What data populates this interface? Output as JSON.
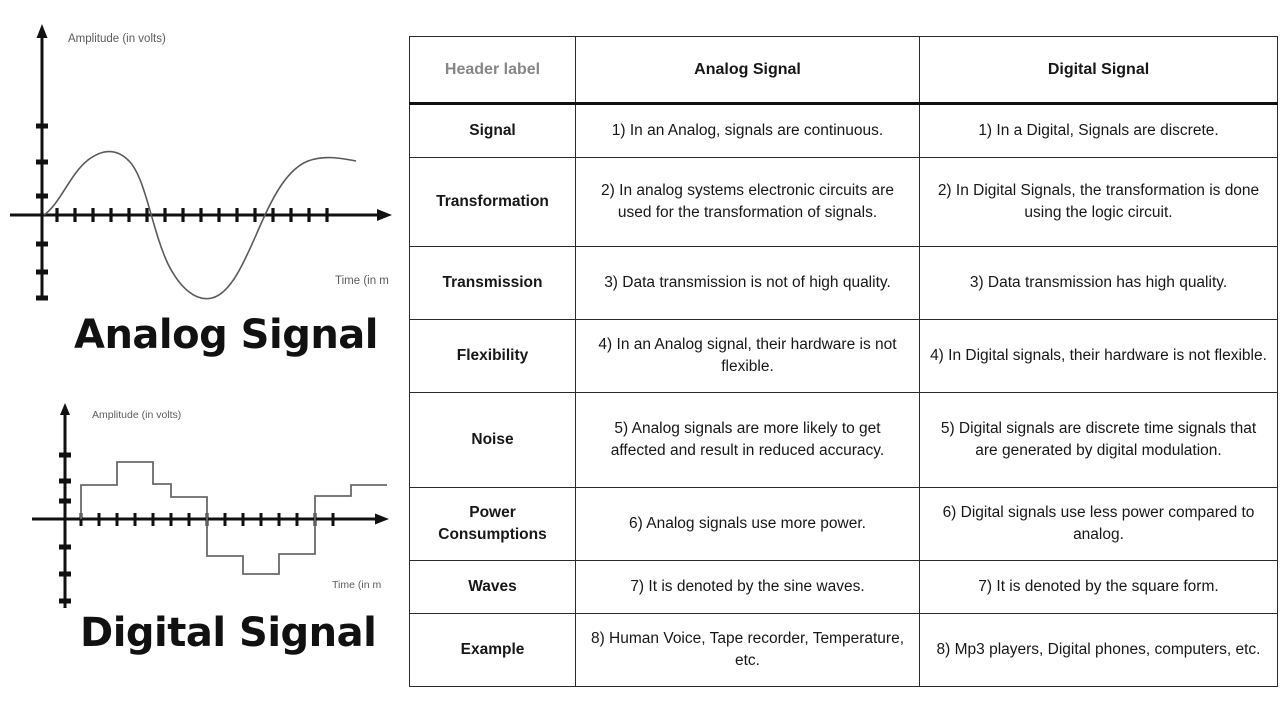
{
  "figures": {
    "analog": {
      "caption": "Analog Signal",
      "y_axis_label": "Amplitude (in volts)",
      "x_axis_label": "Time (in m"
    },
    "digital": {
      "caption": "Digital Signal",
      "y_axis_label": "Amplitude (in volts)",
      "x_axis_label": "Time (in m"
    }
  },
  "chart_data": [
    {
      "type": "line",
      "title": "Analog Signal",
      "xlabel": "Time (in m",
      "ylabel": "Amplitude (in volts)",
      "grid": false,
      "legend": "none",
      "x_tick_count": 17,
      "y_tick_count_positive": 3,
      "y_tick_count_negative": 3,
      "xlim": [
        0,
        16
      ],
      "ylim": [
        -3,
        3
      ],
      "series": [
        {
          "name": "analog sine",
          "x": [
            0,
            1,
            2,
            3,
            4,
            5,
            6,
            7,
            8,
            9,
            10,
            11,
            12,
            13,
            14,
            15,
            16
          ],
          "values": [
            0,
            1.1,
            1.85,
            2.0,
            1.6,
            0.7,
            -0.45,
            -1.5,
            -2.1,
            -2.2,
            -1.75,
            -0.7,
            0.4,
            1.35,
            1.85,
            2.0,
            2.0
          ]
        }
      ]
    },
    {
      "type": "line",
      "title": "Digital Signal",
      "xlabel": "Time (in m",
      "ylabel": "Amplitude (in volts)",
      "grid": false,
      "legend": "none",
      "step_style": "post",
      "x_tick_count": 17,
      "y_tick_count_positive": 3,
      "y_tick_count_negative": 3,
      "xlim": [
        0,
        16
      ],
      "ylim": [
        -3,
        3
      ],
      "series": [
        {
          "name": "digital steps",
          "x": [
            0,
            1,
            2,
            3,
            4,
            5,
            6,
            7,
            8,
            9,
            10,
            11,
            12,
            13,
            14,
            15,
            16
          ],
          "values": [
            0,
            0,
            1.3,
            1.9,
            1.9,
            1.2,
            1.2,
            0.8,
            0.8,
            -1.5,
            -1.5,
            -2.1,
            -2.1,
            -1.5,
            -1.5,
            0.8,
            1.3
          ]
        }
      ]
    }
  ],
  "table": {
    "headers": {
      "col1": "Header label",
      "col2": "Analog Signal",
      "col3": "Digital Signal"
    },
    "rows": [
      {
        "label": "Signal",
        "analog": "1) In an Analog, signals are continuous.",
        "digital": "1) In a Digital, Signals are discrete."
      },
      {
        "label": "Transformation",
        "analog": "2) In analog systems electronic circuits are\nused for the transformation of signals.",
        "digital": "2) In Digital Signals, the transformation is done using the logic circuit."
      },
      {
        "label": "Transmission",
        "analog": "3) Data transmission is not of high quality.",
        "digital": "3) Data transmission has high quality."
      },
      {
        "label": "Flexibility",
        "analog": "4) In an Analog signal, their hardware is not flexible.",
        "digital": "4) In Digital signals, their hardware is not flexible."
      },
      {
        "label": "Noise",
        "analog": "5) Analog signals are more likely to get affected and result in reduced accuracy.",
        "digital": "5) Digital signals are discrete time signals that are generated by digital modulation."
      },
      {
        "label": "Power\nConsumptions",
        "analog": "6) Analog signals use more power.",
        "digital": "6) Digital signals use less power compared to analog."
      },
      {
        "label": "Waves",
        "analog": "7) It is denoted by the sine waves.",
        "digital": "7) It is denoted by the square form."
      },
      {
        "label": "Example",
        "analog": "8) Human Voice, Tape recorder, Temperature, etc.",
        "digital": "8) Mp3 players, Digital phones, computers, etc."
      }
    ]
  },
  "colors": {
    "text": "#171717",
    "header_label_gray": "#868686",
    "border": "#2b2b2b",
    "axis": "#111111",
    "waveform": "#555555",
    "background": "#ffffff"
  }
}
